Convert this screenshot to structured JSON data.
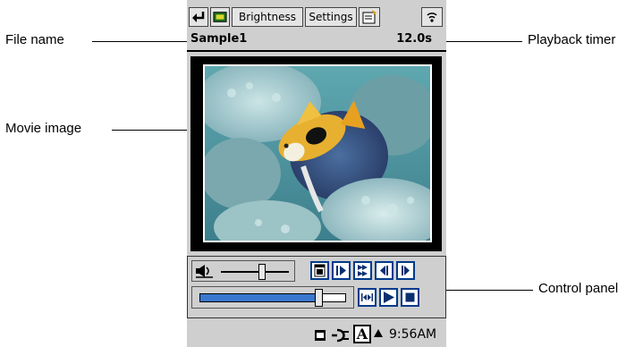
{
  "callouts": {
    "file_name": "File name",
    "movie_image": "Movie image",
    "playback_timer": "Playback timer",
    "control_panel": "Control panel"
  },
  "toolbar": {
    "brightness_label": "Brightness",
    "settings_label": "Settings"
  },
  "header": {
    "file_name": "Sample1",
    "timer": "12.0s"
  },
  "controls": {
    "volume_level": 0.6,
    "playback_position": 0.82
  },
  "status_bar": {
    "clock": "9:56AM",
    "input_indicator": "A"
  },
  "colors": {
    "accent": "#1f5fbf",
    "progress_fill": "#3a78d0"
  }
}
